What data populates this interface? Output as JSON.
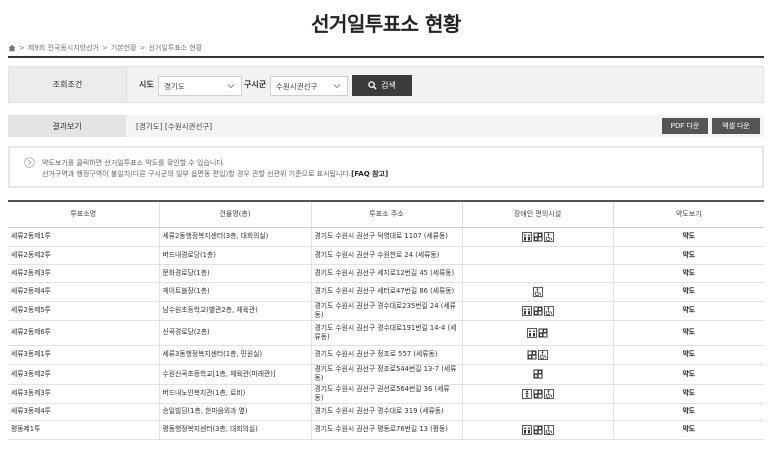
{
  "page": {
    "title": "선거일투표소 현황",
    "breadcrumb": [
      "제9회 전국동시지방선거",
      "기본현황",
      "선거일투표소 현황"
    ]
  },
  "search": {
    "label": "조회조건",
    "sido_label": "시도",
    "sido_value": "경기도",
    "gusigun_label": "구시군",
    "gusigun_value": "수원시권선구",
    "button": "검색"
  },
  "result": {
    "label": "결과보기",
    "text": "[경기도] [수원시권선구]",
    "pdf_button": "PDF 다운",
    "excel_button": "엑셀 다운"
  },
  "notice": {
    "line1": "약도보기를 클릭하면 선거일투표소 약도를 확인할 수 있습니다.",
    "line2": "선거구역과 행정구역이 불일치(다른 구시군의 일부 읍면동 편입)할 경우 관할 선관위 기준으로 표시됩니다.",
    "faq": "[FAQ 참고]"
  },
  "table": {
    "headers": [
      "투표소명",
      "건물명(층)",
      "투표소 주소",
      "장애인 편의시설",
      "약도보기"
    ],
    "rows": [
      {
        "name": "세류2동제1투",
        "building": "세류2동행정복지센터(3층, 대회의실)",
        "address": "경기도 수원시 권선구 덕영대로 1107 (세류동)",
        "icons": [
          "elevator-icon",
          "toilet-icon",
          "wheelchair-icon"
        ],
        "map": "약도"
      },
      {
        "name": "세류2동제2투",
        "building": "버드내경로당(1층)",
        "address": "경기도 수원시 권선구 수원천로 24 (세류동)",
        "icons": [],
        "map": "약도"
      },
      {
        "name": "세류2동제3투",
        "building": "문화경로당(1층)",
        "address": "경기도 수원시 권선구 세지로12번길 45 (세류동)",
        "icons": [],
        "map": "약도"
      },
      {
        "name": "세류2동제4투",
        "building": "게이트볼장(1층)",
        "address": "경기도 수원시 권선구 세터로47번길 86 (세류동)",
        "icons": [
          "wheelchair-icon"
        ],
        "map": "약도"
      },
      {
        "name": "세류2동제5투",
        "building": "남수원초등학교(별관2층, 체육관)",
        "address": "경기도 수원시 권선구 경수대로235번길 24 (세류동)",
        "icons": [
          "elevator-icon",
          "toilet-icon",
          "wheelchair-icon"
        ],
        "map": "약도"
      },
      {
        "name": "세류2동제6투",
        "building": "신곡경로당(2층)",
        "address": "경기도 수원시 권선구 경수대로191번길 14-4 (세류동)",
        "icons": [
          "elevator-icon",
          "toilet-icon"
        ],
        "map": "약도"
      },
      {
        "name": "세류3동제1투",
        "building": "세류3동행정복지센터(1층, 민원실)",
        "address": "경기도 수원시 권선구 정조로 557 (세류동)",
        "icons": [
          "toilet-icon",
          "wheelchair-icon"
        ],
        "map": "약도"
      },
      {
        "name": "세류3동제2투",
        "building": "수원신곡초등학교[1층, 체육관(미래관)]",
        "address": "경기도 수원시 권선구 정조로544번길 13-7 (세류동)",
        "icons": [
          "toilet-icon"
        ],
        "map": "약도"
      },
      {
        "name": "세류3동제3투",
        "building": "버드내노인복지관(1층, 로비)",
        "address": "경기도 수원시 권선구 권선로564번길 36 (세류동)",
        "icons": [
          "ramp-icon",
          "toilet-icon",
          "wheelchair-icon"
        ],
        "map": "약도"
      },
      {
        "name": "세류3동제4투",
        "building": "승일빌딩(1층, 한마음외과 옆)",
        "address": "경기도 수원시 권선구 경수대로 319 (세류동)",
        "icons": [],
        "map": "약도"
      },
      {
        "name": "평동제1투",
        "building": "평동행정복지센터(3층, 대회의실)",
        "address": "경기도 수원시 권선구 평동로76번길 13 (평동)",
        "icons": [
          "elevator-icon",
          "toilet-icon",
          "wheelchair-icon"
        ],
        "map": "약도"
      }
    ]
  }
}
